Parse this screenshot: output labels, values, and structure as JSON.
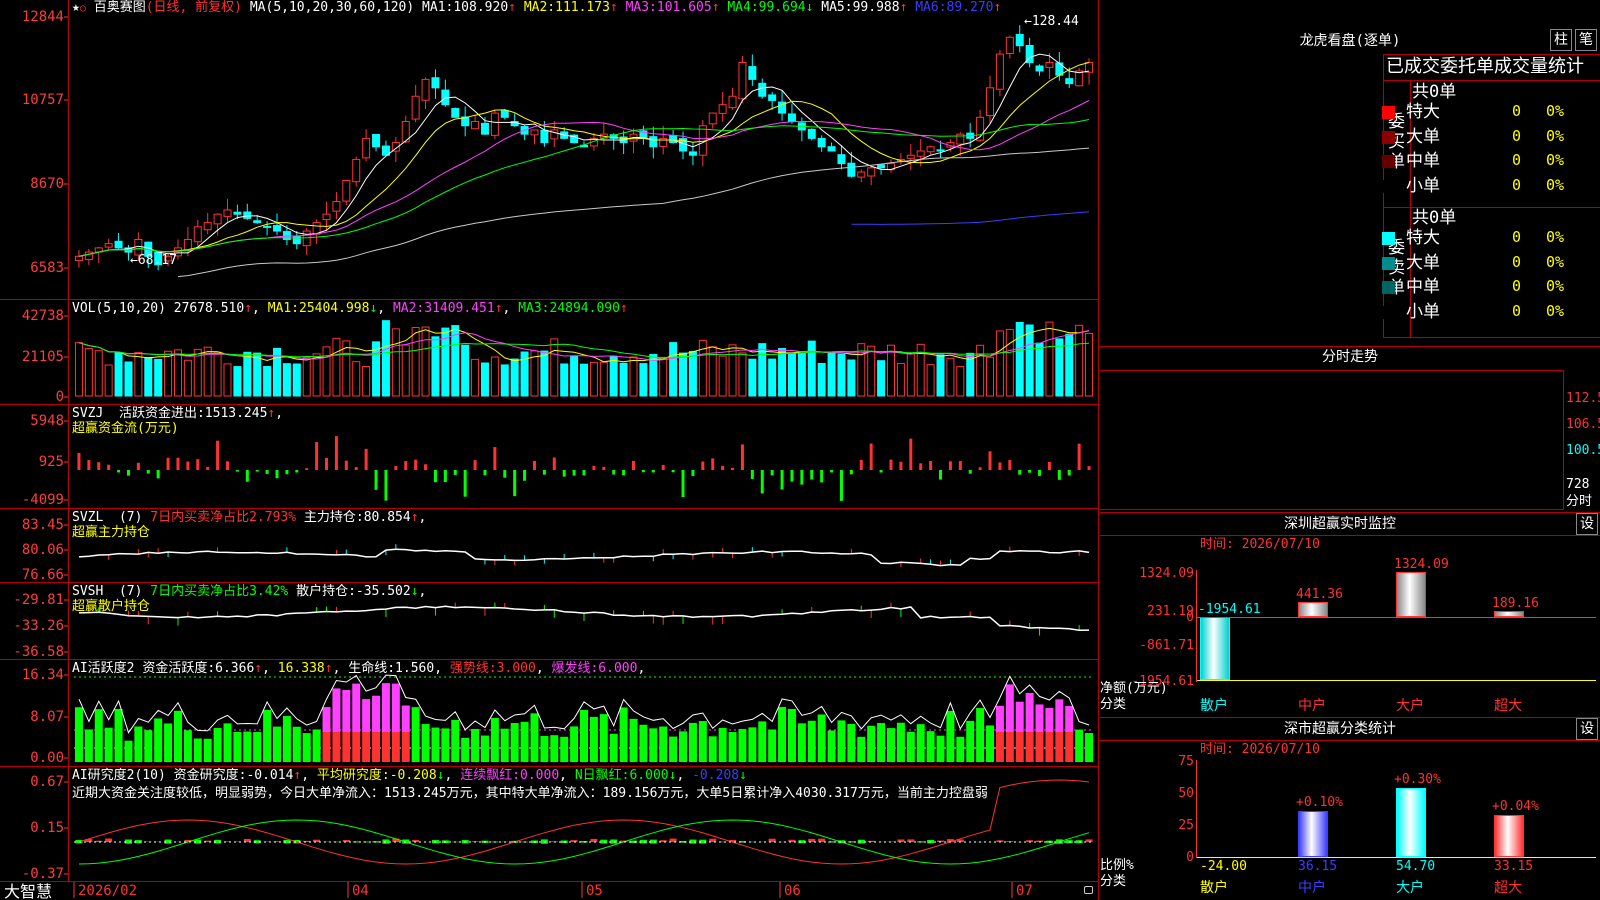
{
  "app_name": "大智慧",
  "colors": {
    "red": "#ff3232",
    "cyan": "#00ffff",
    "green": "#00ff00",
    "yellow": "#ffff00",
    "magenta": "#ff40ff",
    "white": "#ffffff",
    "blue": "#3c3cff",
    "panel_border": "#b40000"
  },
  "icons": {
    "star": "star-icon",
    "close": "red-dot-icon"
  },
  "kline": {
    "title_star": "★",
    "title_name": "百奥赛图",
    "title_mode": "(日线, 前复权)",
    "ma_def": "MA(5,10,20,30,60,120)",
    "ma": [
      {
        "label": "MA1:",
        "value": "108.920",
        "arrow": "↑"
      },
      {
        "label": "MA2:",
        "value": "111.173",
        "arrow": "↑"
      },
      {
        "label": "MA3:",
        "value": "101.605",
        "arrow": "↑"
      },
      {
        "label": "MA4:",
        "value": "99.694",
        "arrow": "↓"
      },
      {
        "label": "MA5:",
        "value": "99.988",
        "arrow": "↑"
      },
      {
        "label": "MA6:",
        "value": "89.270",
        "arrow": "↑"
      }
    ],
    "y_labels": [
      "12844",
      "10757",
      "8670",
      "6583"
    ],
    "high_label": "128.44",
    "low_label": "68.17",
    "series": {
      "close": [
        72,
        73,
        74,
        75,
        74,
        73,
        76,
        72,
        70,
        72,
        74,
        76,
        79,
        80,
        82,
        83,
        82,
        81,
        80,
        79,
        78,
        76,
        75,
        78,
        80,
        82,
        85,
        90,
        95,
        100,
        98,
        96,
        99,
        104,
        110,
        114,
        112,
        108,
        105,
        103,
        104,
        101,
        106,
        105,
        103,
        101,
        102,
        99,
        102,
        100,
        99,
        98,
        100,
        101,
        100,
        99,
        101,
        100,
        98,
        100,
        99,
        97,
        96,
        103,
        106,
        108,
        110,
        118,
        114,
        110,
        109,
        106,
        104,
        102,
        100,
        98,
        97,
        94,
        91,
        92,
        93,
        93,
        94,
        95,
        96,
        97,
        98,
        97,
        99,
        101,
        100,
        105,
        112,
        120,
        124,
        122,
        118,
        116,
        118,
        115,
        113,
        116,
        118
      ]
    }
  },
  "vol": {
    "name": "VOL(5,10,20)",
    "value": "27678.510",
    "value_arrow": "↑",
    "ma": [
      {
        "label": "MA1:",
        "value": "25404.998",
        "arrow": "↓"
      },
      {
        "label": "MA2:",
        "value": "31409.451",
        "arrow": "↑"
      },
      {
        "label": "MA3:",
        "value": "24894.090",
        "arrow": "↑"
      }
    ],
    "y_labels": [
      "42738",
      "21105",
      "0"
    ]
  },
  "svzj": {
    "name": "SVZJ",
    "label": "活跃资金进出:",
    "value": "1513.245",
    "arrow": "↑",
    "sub": "超赢资金流(万元)",
    "y_labels": [
      "5948",
      "925",
      "-4099"
    ]
  },
  "svzl": {
    "name": "SVZL",
    "period": "(7)",
    "label": "7日内买卖净占比2.793%",
    "label2": "主力持仓:",
    "value": "80.854",
    "arrow": "↑",
    "sub": "超赢主力持仓",
    "y_labels": [
      "83.45",
      "80.06",
      "76.66"
    ]
  },
  "svsh": {
    "name": "SVSH",
    "period": "(7)",
    "label": "7日内买卖净占比3.42%",
    "label2": "散户持仓:",
    "value": "-35.502",
    "arrow": "↓",
    "sub": "超赢散户持仓",
    "y_labels": [
      "-29.81",
      "-33.26",
      "-36.58"
    ]
  },
  "ai1": {
    "name": "AI活跃度2",
    "label": "资金活跃度:",
    "value": "6.366",
    "value2": "16.338",
    "label3": "生命线:",
    "value3": "1.560",
    "label4": "强势线:",
    "value4": "3.000",
    "label5": "爆发线:",
    "value5": "6.000",
    "y_labels": [
      "16.34",
      "8.07",
      "0.00"
    ]
  },
  "ai2": {
    "name": "AI研究度2(10)",
    "label": "资金研究度:",
    "value": "-0.014",
    "label2": "平均研究度:",
    "value2": "-0.208",
    "label3": "连续飘红:",
    "value3": "0.000",
    "label4": "N日飘红:",
    "value4": "6.000",
    "value5": "-0.208",
    "comment": "近期大资金关注度较低，明显弱势，今日大单净流入：1513.245万元，其中特大单净流入：189.156万元，大单5日累计净入4030.317万元，当前主力控盘弱",
    "y_labels": [
      "0.67",
      "0.15",
      "-0.37"
    ]
  },
  "x_axis": {
    "dates": [
      "2026/02",
      "04",
      "05",
      "06",
      "07"
    ]
  },
  "lhb": {
    "title": "龙虎看盘(逐单)",
    "btn1": "柱",
    "btn2": "笔",
    "tabs_title": "已成交委托单成交量统计",
    "buy": {
      "side_label": "委买单",
      "total": "共0单",
      "rows": [
        {
          "label": "特大",
          "count": "0",
          "pct": "0%",
          "color": "#ff0000"
        },
        {
          "label": "大单",
          "count": "0",
          "pct": "0%",
          "color": "#8c0000"
        },
        {
          "label": "中单",
          "count": "0",
          "pct": "0%",
          "color": "#640000"
        },
        {
          "label": "小单",
          "count": "0",
          "pct": "0%",
          "color": "#000000"
        }
      ]
    },
    "sell": {
      "side_label": "委卖单",
      "total": "共0单",
      "rows": [
        {
          "label": "特大",
          "count": "0",
          "pct": "0%",
          "color": "#00ffff"
        },
        {
          "label": "大单",
          "count": "0",
          "pct": "0%",
          "color": "#008c8c"
        },
        {
          "label": "中单",
          "count": "0",
          "pct": "0%",
          "color": "#006464"
        },
        {
          "label": "小单",
          "count": "0",
          "pct": "0%",
          "color": "#000000"
        }
      ]
    }
  },
  "intraday": {
    "title": "分时走势",
    "y_labels": [
      "112.5",
      "106.5",
      "100.5",
      "728"
    ],
    "time_label": "分时"
  },
  "sz_monitor": {
    "title": "深圳超赢实时监控",
    "set_btn": "设",
    "time": "时间: 2026/07/10",
    "y_labels": [
      "1324.09",
      "231.19",
      "0",
      "-861.71",
      "-1954.61"
    ],
    "net_label": "净额(万元)",
    "cat_label": "分类",
    "bars": [
      {
        "name": "散户",
        "value": "-1954.61",
        "color": "#00ffff"
      },
      {
        "name": "中户",
        "value": "441.36",
        "color": "#ff3232"
      },
      {
        "name": "大户",
        "value": "1324.09",
        "color": "#ff3232"
      },
      {
        "name": "超大",
        "value": "189.16",
        "color": "#ff3232"
      }
    ]
  },
  "sz_stats": {
    "title": "深市超赢分类统计",
    "set_btn": "设",
    "time": "时间: 2026/07/10",
    "y_labels": [
      "75",
      "50",
      "25",
      "0"
    ],
    "ratio_label": "比例%",
    "cat_label": "分类",
    "bars": [
      {
        "name": "散户",
        "value": "-24.00",
        "delta": "",
        "color": "#ffff00"
      },
      {
        "name": "中户",
        "value": "36.15",
        "delta": "+0.10%",
        "color": "#3c3cff"
      },
      {
        "name": "大户",
        "value": "54.70",
        "delta": "+0.30%",
        "color": "#00ffff"
      },
      {
        "name": "超大",
        "value": "33.15",
        "delta": "+0.04%",
        "color": "#ff3232"
      }
    ]
  }
}
